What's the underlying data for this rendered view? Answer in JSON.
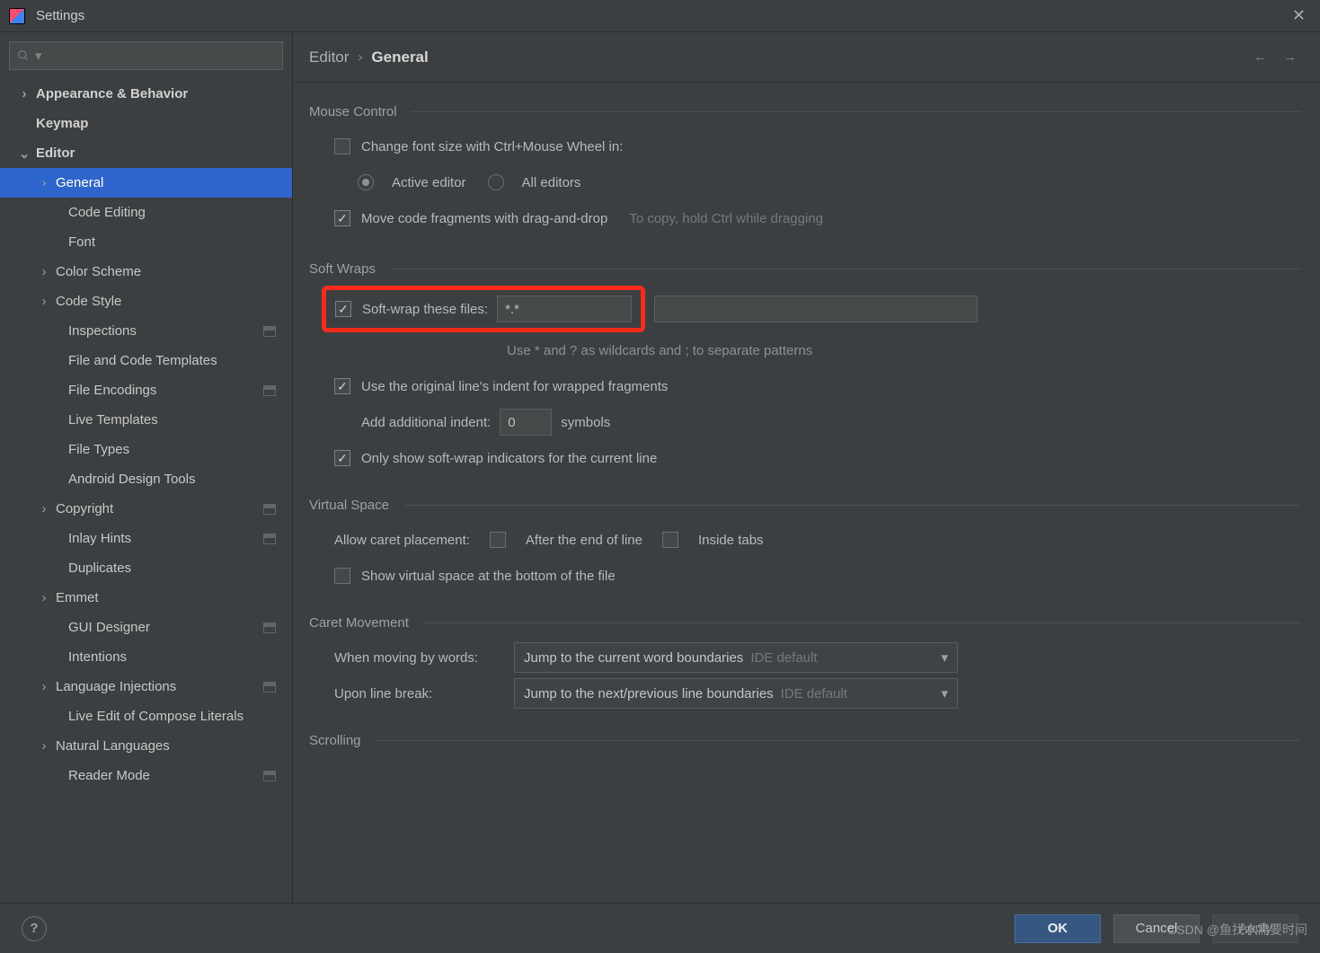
{
  "window": {
    "title": "Settings"
  },
  "search": {
    "placeholder": ""
  },
  "breadcrumb": {
    "parent": "Editor",
    "sep": "›",
    "current": "General"
  },
  "sidebar": {
    "items": [
      {
        "label": "Appearance & Behavior",
        "bold": true,
        "expandable": true,
        "expanded": false,
        "level": 0
      },
      {
        "label": "Keymap",
        "bold": true,
        "expandable": false,
        "level": 0
      },
      {
        "label": "Editor",
        "bold": true,
        "expandable": true,
        "expanded": true,
        "level": 0
      },
      {
        "label": "General",
        "expandable": true,
        "expanded": false,
        "level": 1,
        "selected": true
      },
      {
        "label": "Code Editing",
        "level": 1
      },
      {
        "label": "Font",
        "level": 1
      },
      {
        "label": "Color Scheme",
        "expandable": true,
        "expanded": false,
        "level": 1
      },
      {
        "label": "Code Style",
        "expandable": true,
        "expanded": false,
        "level": 1
      },
      {
        "label": "Inspections",
        "level": 1,
        "badge": true
      },
      {
        "label": "File and Code Templates",
        "level": 1
      },
      {
        "label": "File Encodings",
        "level": 1,
        "badge": true
      },
      {
        "label": "Live Templates",
        "level": 1
      },
      {
        "label": "File Types",
        "level": 1
      },
      {
        "label": "Android Design Tools",
        "level": 1
      },
      {
        "label": "Copyright",
        "expandable": true,
        "expanded": false,
        "level": 1,
        "badge": true
      },
      {
        "label": "Inlay Hints",
        "level": 1,
        "badge": true
      },
      {
        "label": "Duplicates",
        "level": 1
      },
      {
        "label": "Emmet",
        "expandable": true,
        "expanded": false,
        "level": 1
      },
      {
        "label": "GUI Designer",
        "level": 1,
        "badge": true
      },
      {
        "label": "Intentions",
        "level": 1
      },
      {
        "label": "Language Injections",
        "expandable": true,
        "expanded": false,
        "level": 1,
        "badge": true
      },
      {
        "label": "Live Edit of Compose Literals",
        "level": 1
      },
      {
        "label": "Natural Languages",
        "expandable": true,
        "expanded": false,
        "level": 1
      },
      {
        "label": "Reader Mode",
        "level": 1,
        "badge": true
      }
    ]
  },
  "sections": {
    "mouse": {
      "title": "Mouse Control",
      "change_font": {
        "label": "Change font size with Ctrl+Mouse Wheel in:",
        "checked": false
      },
      "radio_active": {
        "label": "Active editor",
        "on": true
      },
      "radio_all": {
        "label": "All editors",
        "on": false
      },
      "drag_drop": {
        "label": "Move code fragments with drag-and-drop",
        "checked": true,
        "hint": "To copy, hold Ctrl while dragging"
      }
    },
    "softwraps": {
      "title": "Soft Wraps",
      "wrap_files": {
        "label": "Soft-wrap these files:",
        "checked": true,
        "value": "*.*"
      },
      "wildcards_hint": "Use * and ? as wildcards and ; to separate patterns",
      "original_indent": {
        "label": "Use the original line's indent for wrapped fragments",
        "checked": true
      },
      "add_indent": {
        "label": "Add additional indent:",
        "value": "0",
        "suffix": "symbols"
      },
      "only_current": {
        "label": "Only show soft-wrap indicators for the current line",
        "checked": true
      }
    },
    "virtual": {
      "title": "Virtual Space",
      "allow_label": "Allow caret placement:",
      "after_eol": {
        "label": "After the end of line",
        "checked": false
      },
      "inside_tabs": {
        "label": "Inside tabs",
        "checked": false
      },
      "show_bottom": {
        "label": "Show virtual space at the bottom of the file",
        "checked": false
      }
    },
    "caret": {
      "title": "Caret Movement",
      "by_words": {
        "label": "When moving by words:",
        "value": "Jump to the current word boundaries",
        "suffix": "IDE default"
      },
      "line_break": {
        "label": "Upon line break:",
        "value": "Jump to the next/previous line boundaries",
        "suffix": "IDE default"
      }
    },
    "scrolling": {
      "title": "Scrolling"
    }
  },
  "footer": {
    "ok": "OK",
    "cancel": "Cancel",
    "apply": "Apply"
  },
  "watermark": "CSDN @鱼找水需要时间"
}
